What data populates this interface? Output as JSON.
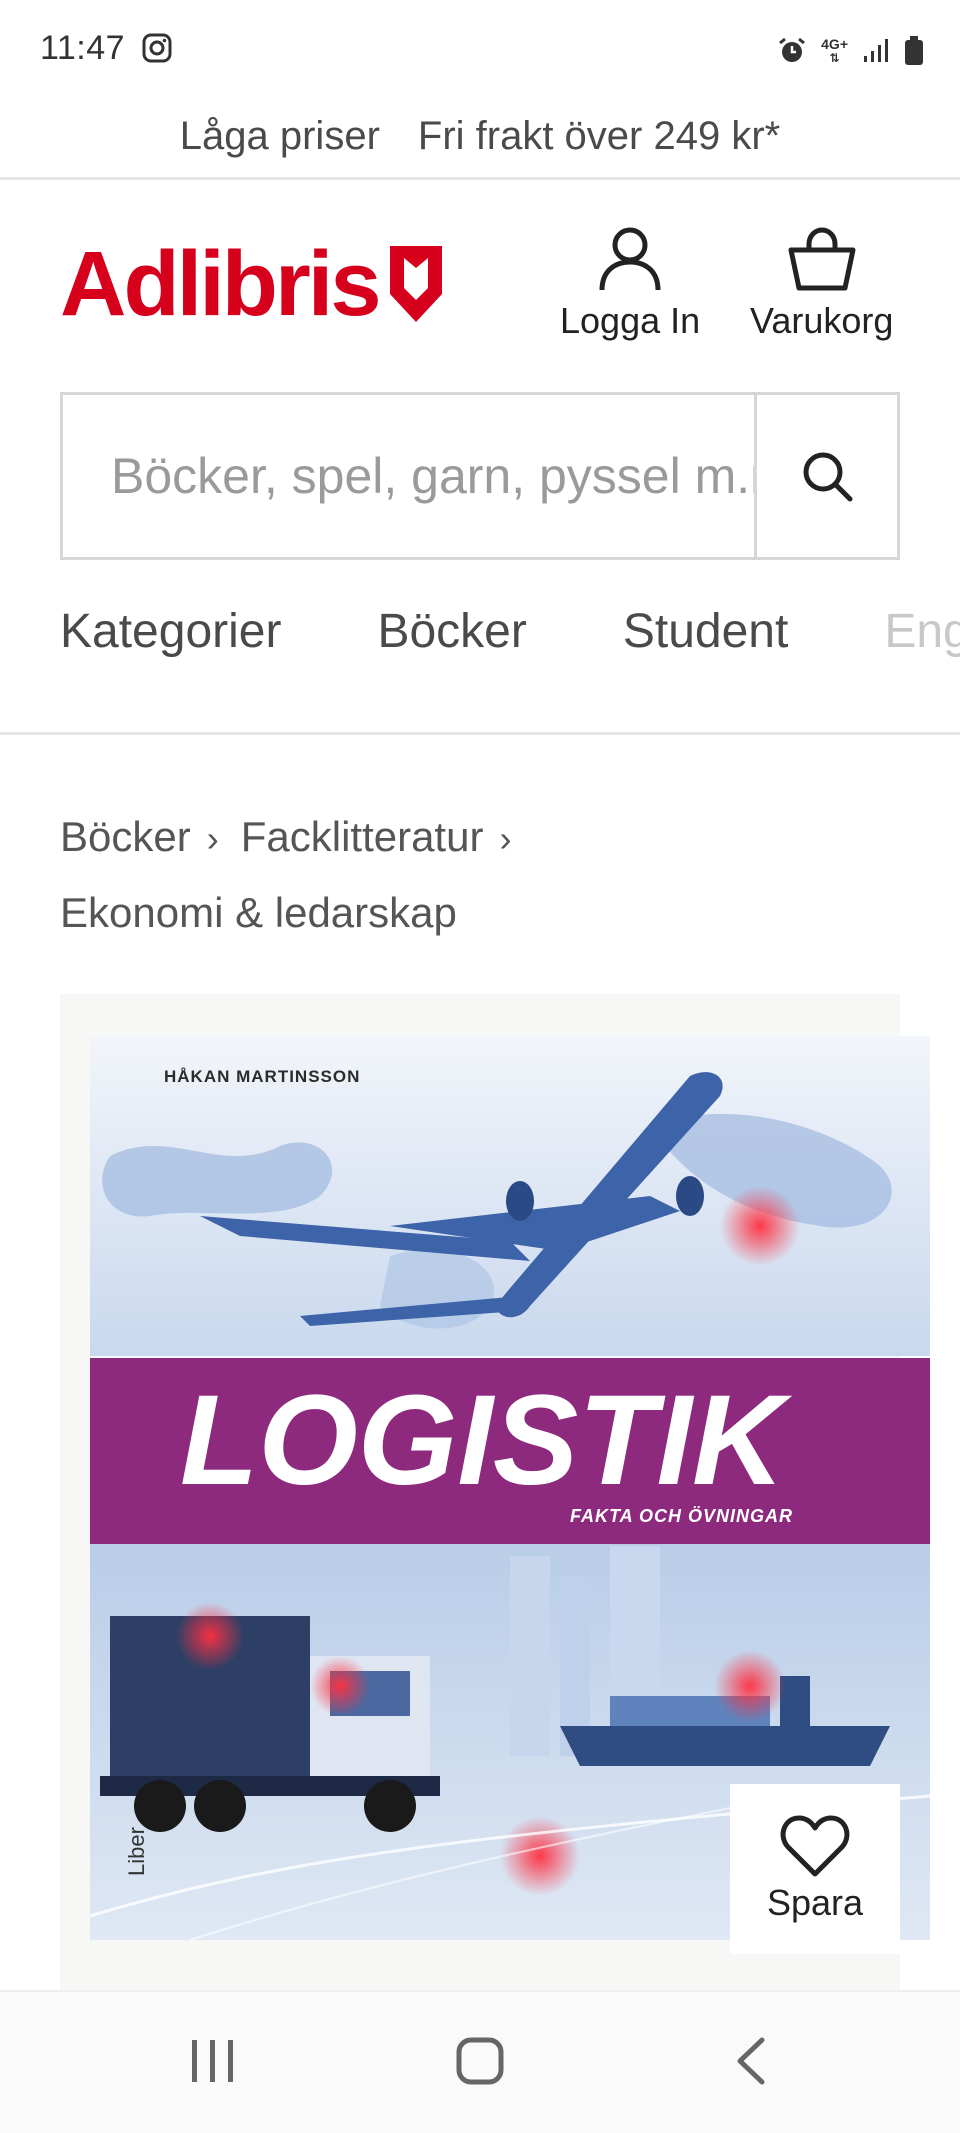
{
  "status_bar": {
    "time": "11:47",
    "network": "4G+",
    "icons": [
      "instagram-icon",
      "alarm-icon",
      "signal-icon",
      "battery-icon"
    ]
  },
  "promo": {
    "item1": "Låga priser",
    "item2": "Fri frakt över 249 kr*"
  },
  "header": {
    "logo_text": "Adlibris",
    "login_label": "Logga In",
    "cart_label": "Varukorg",
    "brand_color": "#d6001c"
  },
  "search": {
    "placeholder": "Böcker, spel, garn, pyssel m.m."
  },
  "nav": {
    "items": [
      "Kategorier",
      "Böcker",
      "Student",
      "Engelska"
    ]
  },
  "breadcrumb": {
    "items": [
      "Böcker",
      "Facklitteratur",
      "Ekonomi & ledarskap"
    ]
  },
  "product": {
    "cover": {
      "author": "HÅKAN MARTINSSON",
      "title": "LOGISTIK",
      "subtitle": "FAKTA OCH ÖVNINGAR",
      "publisher": "Liber",
      "band_color": "#8e2a7e"
    },
    "save_label": "Spara"
  }
}
